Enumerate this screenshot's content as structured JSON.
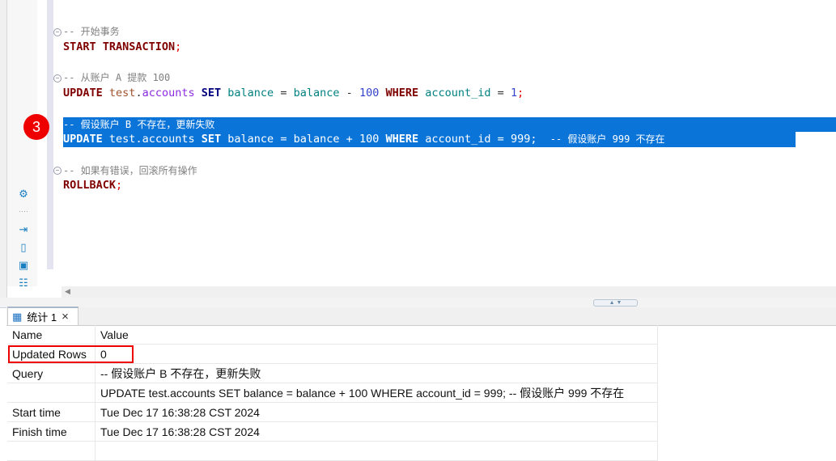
{
  "editor": {
    "lines": [
      {
        "comment": "-- 开始事务"
      },
      {
        "kw": "START TRANSACTION",
        "semi": ";"
      },
      {
        "comment": "-- 从账户 A 提款 100"
      },
      {
        "kw": "UPDATE",
        "schema": "test",
        "dot": ".",
        "table": "accounts",
        "set": "SET",
        "col": "balance",
        "eq": "=",
        "col2": "balance",
        "op": "-",
        "num": "100",
        "where": "WHERE",
        "col3": "account_id",
        "eq2": "=",
        "val": "1",
        "semi": ";"
      },
      {
        "comment": "-- 假设账户 B 不存在，更新失败"
      },
      {
        "kw": "UPDATE",
        "schema": "test",
        "dot": ".",
        "table": "accounts",
        "set": "SET",
        "col": "balance",
        "eq": "=",
        "col2": "balance",
        "op": "+",
        "num": "100",
        "where": "WHERE",
        "col3": "account_id",
        "eq2": "=",
        "val": "999",
        "semi": ";",
        "trail": "-- 假设账户 999 不存在"
      },
      {
        "comment": "-- 如果有错误，回滚所有操作"
      },
      {
        "kw": "ROLLBACK",
        "semi": ";"
      }
    ],
    "annotation_badge": "3"
  },
  "results": {
    "tab_label": "统计 1",
    "close": "×",
    "headers": [
      "Name",
      "Value"
    ],
    "rows": [
      {
        "name": "Updated Rows",
        "value": "0"
      },
      {
        "name": "Query",
        "value": "-- 假设账户 B 不存在，更新失败"
      },
      {
        "name": "",
        "value": "UPDATE test.accounts SET balance = balance + 100 WHERE account_id = 999;  -- 假设账户 999 不存在"
      },
      {
        "name": "Start time",
        "value": "Tue Dec 17 16:38:28 CST 2024"
      },
      {
        "name": "Finish time",
        "value": "Tue Dec 17 16:38:28 CST 2024"
      }
    ]
  },
  "colors": {
    "selection": "#0a74d8",
    "highlight_box": "#e00000"
  }
}
